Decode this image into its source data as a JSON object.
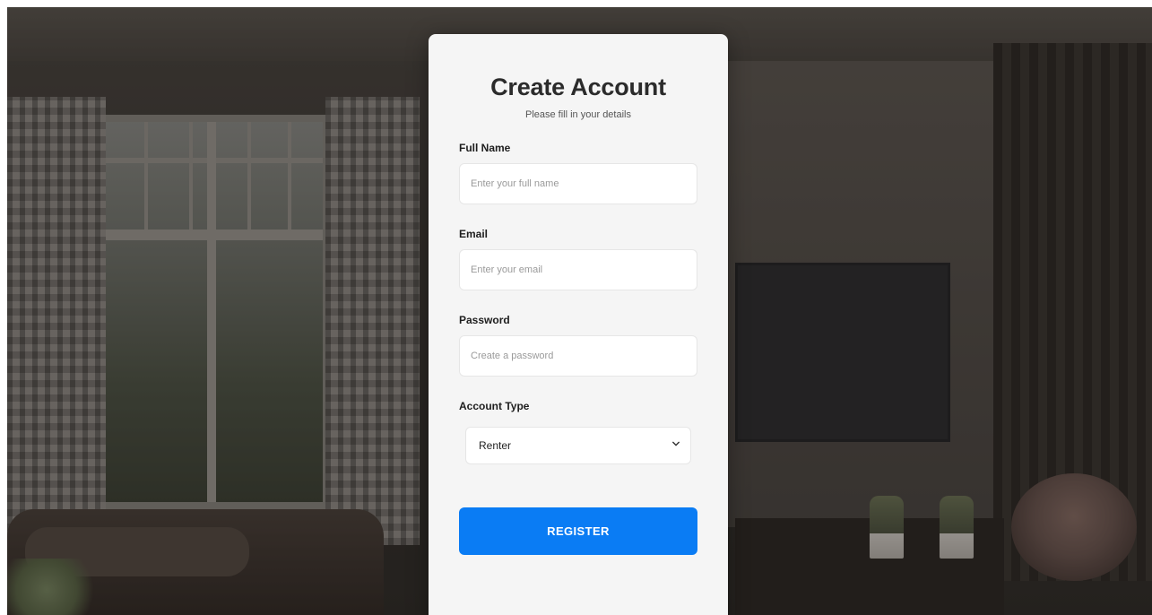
{
  "form": {
    "title": "Create Account",
    "subtitle": "Please fill in your details",
    "full_name": {
      "label": "Full Name",
      "placeholder": "Enter your full name",
      "value": ""
    },
    "email": {
      "label": "Email",
      "placeholder": "Enter your email",
      "value": ""
    },
    "password": {
      "label": "Password",
      "placeholder": "Create a password",
      "value": ""
    },
    "account_type": {
      "label": "Account Type",
      "selected": "Renter"
    },
    "submit_label": "REGISTER"
  },
  "icons": {
    "select_arrow": "chevron-down-icon"
  },
  "colors": {
    "accent": "#0a7cf4",
    "card": "#f5f5f5",
    "title": "#2b2b2b"
  }
}
